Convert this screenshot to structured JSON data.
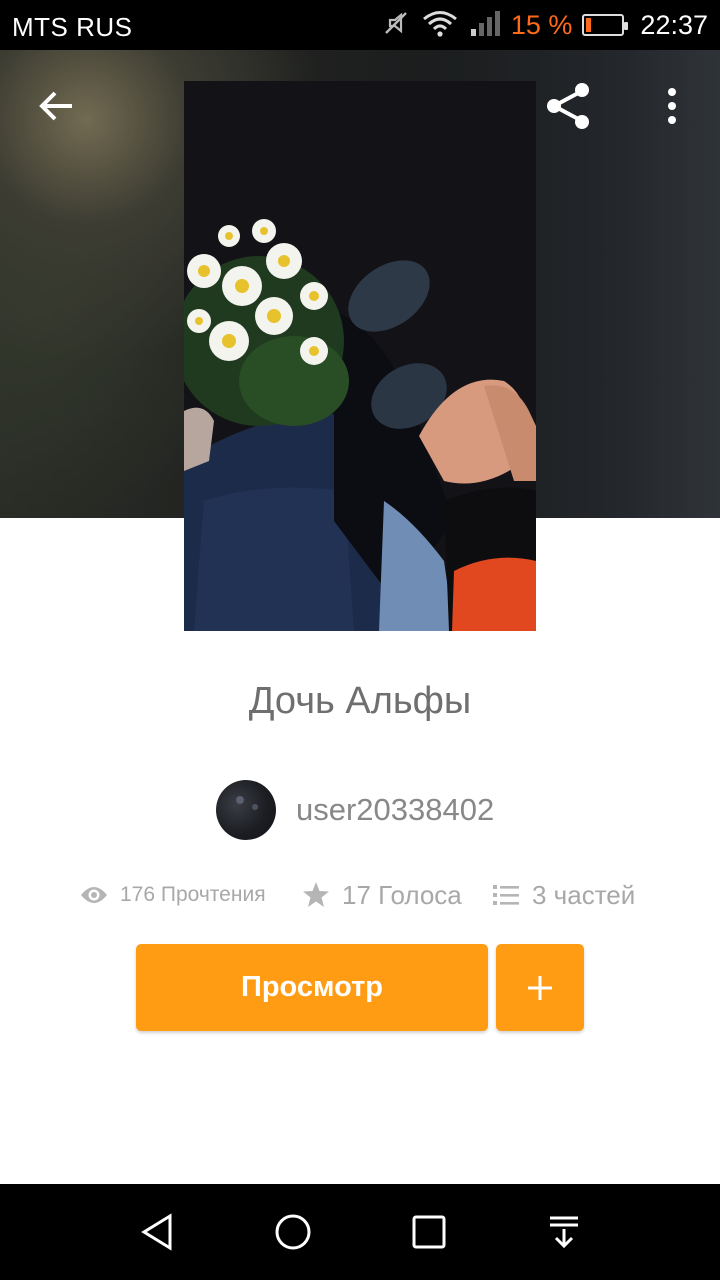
{
  "status_bar": {
    "carrier": "MTS RUS",
    "battery_percent": "15 %",
    "battery_level": 0.15,
    "time": "22:37",
    "icons": [
      "mute-icon",
      "wifi-icon",
      "signal-icon",
      "battery-icon"
    ]
  },
  "toolbar": {
    "back_icon": "arrow-left-icon",
    "share_icon": "share-icon",
    "more_icon": "more-vert-icon"
  },
  "story": {
    "title": "Дочь Альфы",
    "author": "user20338402",
    "stats": {
      "reads": "176 Прочтения",
      "votes": "17 Голоса",
      "parts": "3 частей"
    }
  },
  "actions": {
    "read_label": "Просмотр",
    "add_icon": "plus-icon"
  },
  "colors": {
    "accent": "#ff9c14",
    "battery_low": "#ff6a1a",
    "title_text": "#6f6f6f",
    "stat_text": "#a8a8a8"
  },
  "nav_bar": {
    "icons": [
      "back-triangle-icon",
      "home-circle-icon",
      "recents-square-icon",
      "notification-pull-icon"
    ]
  }
}
